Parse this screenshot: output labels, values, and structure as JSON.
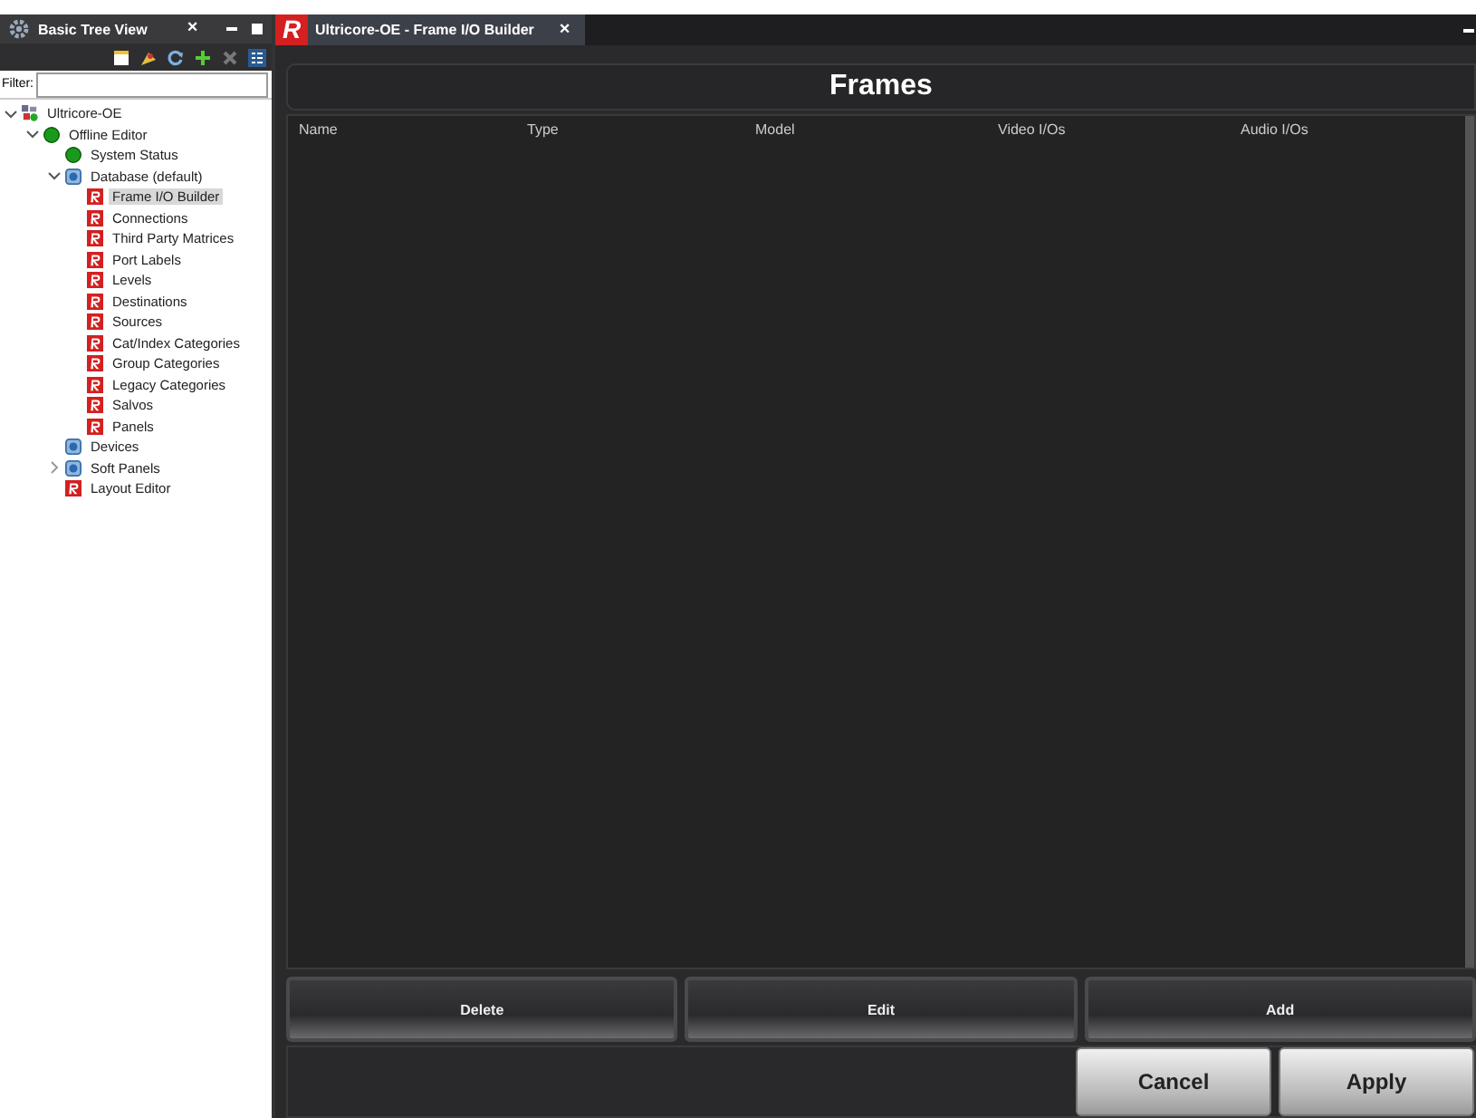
{
  "left_panel": {
    "title": "Basic Tree View",
    "close": "×",
    "filter_label": "Filter:"
  },
  "tree": [
    {
      "label": "Ultricore-OE",
      "kind": "network",
      "expanded": true,
      "selected": false,
      "children": [
        {
          "label": "Offline Editor",
          "kind": "status",
          "expanded": true,
          "selected": false,
          "children": [
            {
              "label": "System Status",
              "kind": "status",
              "selected": false
            },
            {
              "label": "Database (default)",
              "kind": "database",
              "expanded": true,
              "selected": false,
              "children": [
                {
                  "label": "Frame I/O Builder",
                  "kind": "editor",
                  "selected": true
                },
                {
                  "label": "Connections",
                  "kind": "editor",
                  "selected": false
                },
                {
                  "label": "Third Party Matrices",
                  "kind": "editor",
                  "selected": false
                },
                {
                  "label": "Port Labels",
                  "kind": "editor",
                  "selected": false
                },
                {
                  "label": "Levels",
                  "kind": "editor",
                  "selected": false
                },
                {
                  "label": "Destinations",
                  "kind": "editor",
                  "selected": false
                },
                {
                  "label": "Sources",
                  "kind": "editor",
                  "selected": false
                },
                {
                  "label": "Cat/Index Categories",
                  "kind": "editor",
                  "selected": false
                },
                {
                  "label": "Group Categories",
                  "kind": "editor",
                  "selected": false
                },
                {
                  "label": "Legacy Categories",
                  "kind": "editor",
                  "selected": false
                },
                {
                  "label": "Salvos",
                  "kind": "editor",
                  "selected": false
                },
                {
                  "label": "Panels",
                  "kind": "editor",
                  "selected": false
                }
              ]
            },
            {
              "label": "Devices",
              "kind": "database",
              "selected": false
            },
            {
              "label": "Soft Panels",
              "kind": "database",
              "expanded": false,
              "selected": false
            },
            {
              "label": "Layout Editor",
              "kind": "editor",
              "selected": false
            }
          ]
        }
      ]
    }
  ],
  "tab": {
    "title": "Ultricore-OE - Frame I/O Builder",
    "close": "×",
    "logo": "R"
  },
  "heading": "Frames",
  "table": {
    "columns": [
      "Name",
      "Type",
      "Model",
      "Video I/Os",
      "Audio I/Os"
    ]
  },
  "actions": [
    "Delete",
    "Edit",
    "Add"
  ],
  "footer_buttons": [
    "Cancel",
    "Apply"
  ]
}
